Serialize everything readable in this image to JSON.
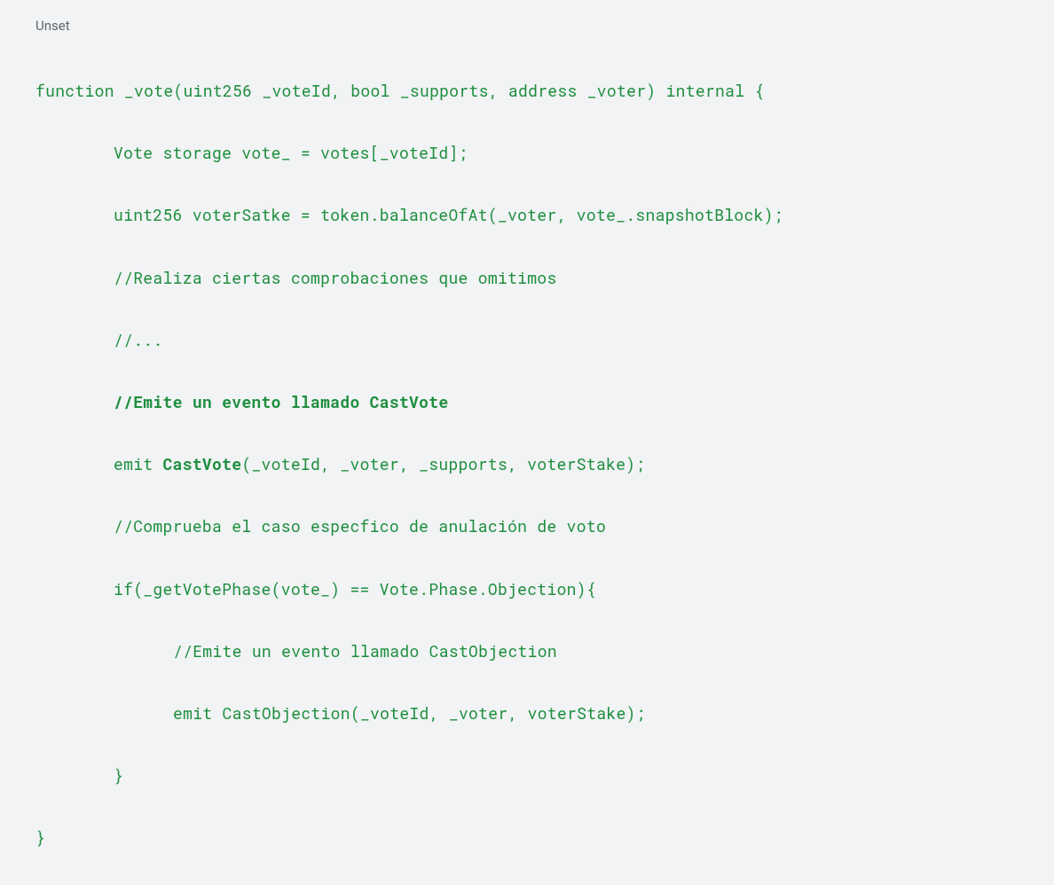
{
  "label": "Unset",
  "code": {
    "line1": "function _vote(uint256 _voteId, bool _supports, address _voter) internal {",
    "line2": "Vote storage vote_ = votes[_voteId];",
    "line3": "uint256 voterSatke = token.balanceOfAt(_voter, vote_.snapshotBlock);",
    "line4": "//Realiza ciertas comprobaciones que omitimos",
    "line5": "//...",
    "line6": "//Emite un evento llamado CastVote",
    "line7a": "emit ",
    "line7b": "CastVote",
    "line7c": "(_voteId, _voter, _supports, voterStake);",
    "line8": "//Comprueba el caso especfico de anulación de voto",
    "line9": "if(_getVotePhase(vote_) == Vote.Phase.Objection){",
    "line10": "//Emite un evento llamado CastObjection",
    "line11": "emit CastObjection(_voteId, _voter, voterStake);",
    "line12": "}",
    "line13": "}"
  }
}
